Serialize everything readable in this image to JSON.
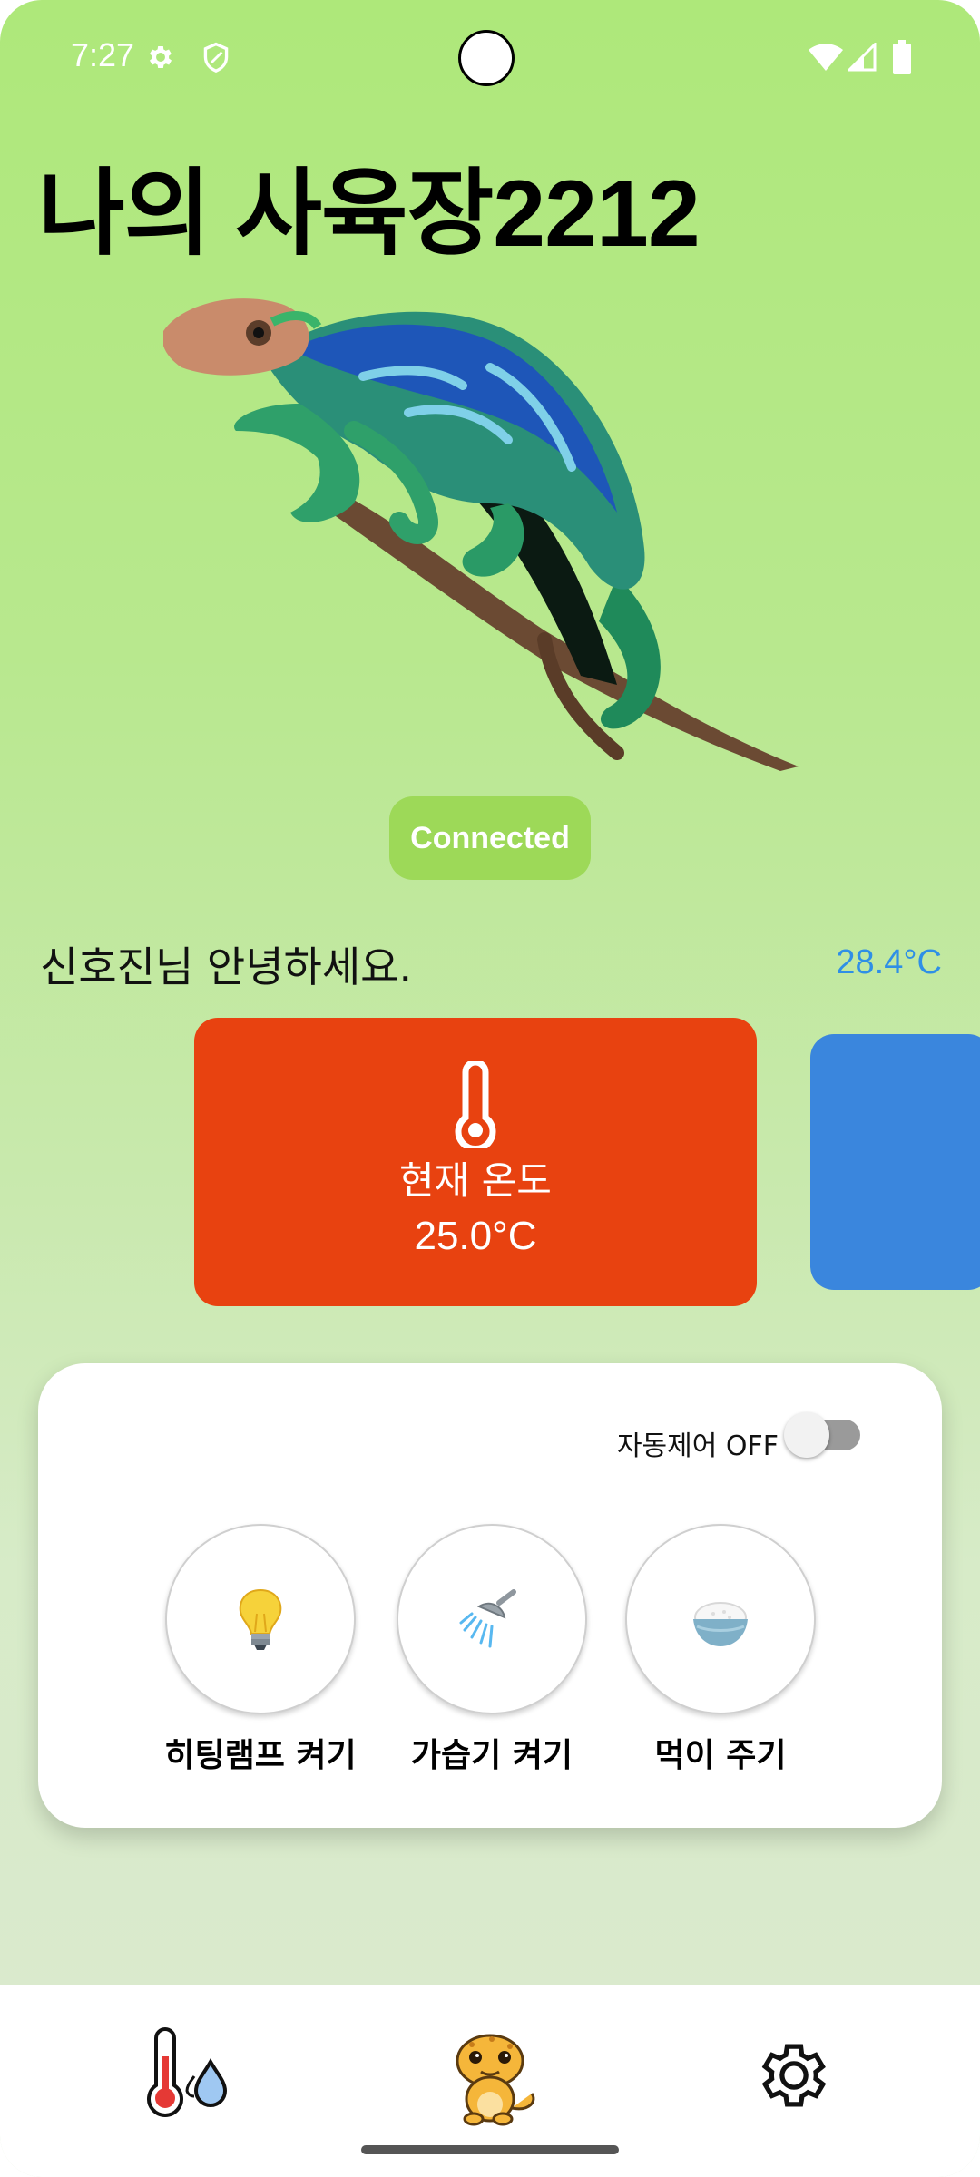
{
  "status_bar": {
    "time": "7:27",
    "icons": [
      "settings-icon",
      "shield-icon",
      "wifi-icon",
      "signal-icon",
      "battery-icon"
    ]
  },
  "header": {
    "title": "나의 사육장2212"
  },
  "hero": {
    "image": "chameleon-illustration"
  },
  "connection": {
    "status": "Connected",
    "color": "#9dd958"
  },
  "greeting": {
    "text": "신호진님 안녕하세요.",
    "temperature": "28.4°C",
    "temperature_color": "#2f8fe6"
  },
  "cards": [
    {
      "icon": "thermometer-icon",
      "label": "현재 온도",
      "value": "25.0°C",
      "color": "#e84210"
    },
    {
      "icon": "",
      "label": "",
      "value": "",
      "color": "#3a86dd"
    }
  ],
  "controls": {
    "auto_control_label": "자동제어 OFF",
    "auto_control_on": false,
    "actions": [
      {
        "icon": "lightbulb-icon",
        "label": "히팅램프 켜기"
      },
      {
        "icon": "shower-head-icon",
        "label": "가습기 켜기"
      },
      {
        "icon": "rice-bowl-icon",
        "label": "먹이 주기"
      }
    ]
  },
  "bottom_nav": {
    "items": [
      {
        "icon": "thermometer-droplet-icon"
      },
      {
        "icon": "gecko-icon",
        "active": true
      },
      {
        "icon": "gear-icon"
      }
    ]
  }
}
